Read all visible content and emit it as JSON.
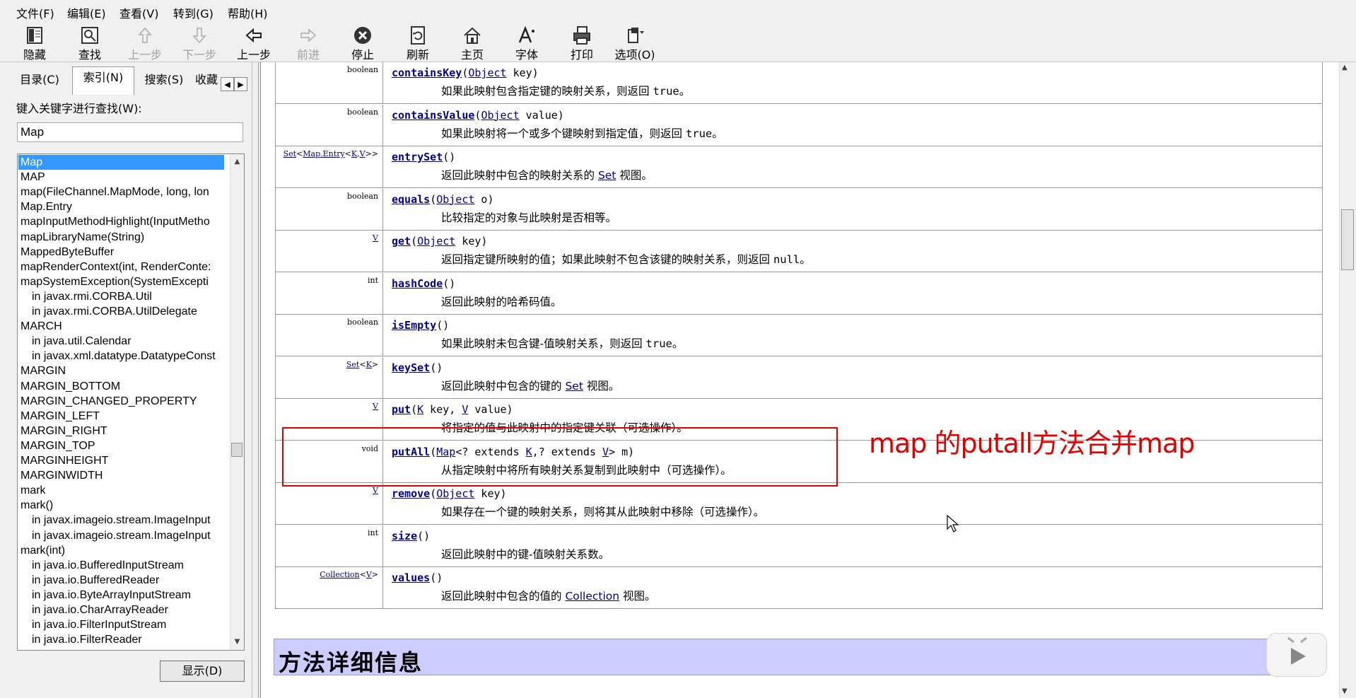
{
  "menu": [
    "文件(F)",
    "编辑(E)",
    "查看(V)",
    "转到(G)",
    "帮助(H)"
  ],
  "toolbar": {
    "hide": "隐藏",
    "find": "查找",
    "prev_topic": "上一步",
    "next_topic": "下一步",
    "back": "上一步",
    "forward": "前进",
    "stop": "停止",
    "refresh": "刷新",
    "home": "主页",
    "font": "字体",
    "print": "打印",
    "options": "选项(O)"
  },
  "sidebar": {
    "tabs": [
      "目录(C)",
      "索引(N)",
      "搜索(S)",
      "收藏"
    ],
    "active_tab": 1,
    "keyword_label": "键入关键字进行查找(W):",
    "keyword_value": "Map",
    "display_button": "显示(D)",
    "items": [
      {
        "text": "Map",
        "indent": false,
        "selected": true
      },
      {
        "text": "MAP",
        "indent": false
      },
      {
        "text": "map(FileChannel.MapMode, long, lon",
        "indent": false
      },
      {
        "text": "Map.Entry",
        "indent": false
      },
      {
        "text": "mapInputMethodHighlight(InputMetho",
        "indent": false
      },
      {
        "text": "mapLibraryName(String)",
        "indent": false
      },
      {
        "text": "MappedByteBuffer",
        "indent": false
      },
      {
        "text": "mapRenderContext(int, RenderConte:",
        "indent": false
      },
      {
        "text": "mapSystemException(SystemExcepti",
        "indent": false
      },
      {
        "text": "in javax.rmi.CORBA.Util",
        "indent": true
      },
      {
        "text": "in javax.rmi.CORBA.UtilDelegate",
        "indent": true
      },
      {
        "text": "MARCH",
        "indent": false
      },
      {
        "text": "in java.util.Calendar",
        "indent": true
      },
      {
        "text": "in javax.xml.datatype.DatatypeConst",
        "indent": true
      },
      {
        "text": "MARGIN",
        "indent": false
      },
      {
        "text": "MARGIN_BOTTOM",
        "indent": false
      },
      {
        "text": "MARGIN_CHANGED_PROPERTY",
        "indent": false
      },
      {
        "text": "MARGIN_LEFT",
        "indent": false
      },
      {
        "text": "MARGIN_RIGHT",
        "indent": false
      },
      {
        "text": "MARGIN_TOP",
        "indent": false
      },
      {
        "text": "MARGINHEIGHT",
        "indent": false
      },
      {
        "text": "MARGINWIDTH",
        "indent": false
      },
      {
        "text": "mark",
        "indent": false
      },
      {
        "text": "mark()",
        "indent": false
      },
      {
        "text": "in javax.imageio.stream.ImageInput",
        "indent": true
      },
      {
        "text": "in javax.imageio.stream.ImageInput",
        "indent": true
      },
      {
        "text": "mark(int)",
        "indent": false
      },
      {
        "text": "in java.io.BufferedInputStream",
        "indent": true
      },
      {
        "text": "in java.io.BufferedReader",
        "indent": true
      },
      {
        "text": "in java.io.ByteArrayInputStream",
        "indent": true
      },
      {
        "text": "in java.io.CharArrayReader",
        "indent": true
      },
      {
        "text": "in java.io.FilterInputStream",
        "indent": true
      },
      {
        "text": "in java.io.FilterReader",
        "indent": true
      }
    ]
  },
  "methods": [
    {
      "type": "boolean",
      "name": "containsKey",
      "sig": "(<a>Object</a> key)",
      "desc": "如果此映射包含指定键的映射关系，则返回 <m>true</m>。"
    },
    {
      "type": "boolean",
      "name": "containsValue",
      "sig": "(<a>Object</a> value)",
      "desc": "如果此映射将一个或多个键映射到指定值，则返回 <m>true</m>。"
    },
    {
      "type": "<a>Set</a>&lt;<a>Map.Entry</a>&lt;<a>K</a>,<a>V</a>&gt;&gt;",
      "name": "entrySet",
      "sig": "()",
      "desc": "返回此映射中包含的映射关系的 <a>Set</a> 视图。"
    },
    {
      "type": "boolean",
      "name": "equals",
      "sig": "(<a>Object</a> o)",
      "desc": "比较指定的对象与此映射是否相等。"
    },
    {
      "type": "<a>V</a>",
      "name": "get",
      "sig": "(<a>Object</a> key)",
      "desc": "返回指定键所映射的值；如果此映射不包含该键的映射关系，则返回 <m>null</m>。"
    },
    {
      "type": "int",
      "name": "hashCode",
      "sig": "()",
      "desc": "返回此映射的哈希码值。"
    },
    {
      "type": "boolean",
      "name": "isEmpty",
      "sig": "()",
      "desc": "如果此映射未包含键-值映射关系，则返回 <m>true</m>。"
    },
    {
      "type": "<a>Set</a>&lt;<a>K</a>&gt;",
      "name": "keySet",
      "sig": "()",
      "desc": "返回此映射中包含的键的 <a>Set</a> 视图。"
    },
    {
      "type": "<a>V</a>",
      "name": "put",
      "sig": "(<a>K</a> key, <a>V</a> value)",
      "desc": "将指定的值与此映射中的指定键关联（可选操作）。"
    },
    {
      "type": "void",
      "name": "putAll",
      "sig": "(<a>Map</a>&lt;? extends <a>K</a>,? extends <a>V</a>&gt; m)",
      "desc": "从指定映射中将所有映射关系复制到此映射中（可选操作）。"
    },
    {
      "type": "<a>V</a>",
      "name": "remove",
      "sig": "(<a>Object</a> key)",
      "desc": "如果存在一个键的映射关系，则将其从此映射中移除（可选操作）。"
    },
    {
      "type": "int",
      "name": "size",
      "sig": "()",
      "desc": "返回此映射中的键-值映射关系数。"
    },
    {
      "type": "<a>Collection</a>&lt;<a>V</a>&gt;",
      "name": "values",
      "sig": "()",
      "desc": "返回此映射中包含的值的 <a>Collection</a> 视图。"
    }
  ],
  "annotation": "map 的putall方法合并map",
  "section_title": "方法详细信息",
  "colors": {
    "link": "#00008b",
    "selection": "#3399ff",
    "annotation": "#e00000",
    "section_bg": "#ccccff"
  },
  "icons": [
    "hide-icon",
    "find-icon",
    "up-arrow-icon",
    "down-arrow-icon",
    "back-arrow-icon",
    "forward-arrow-icon",
    "stop-icon",
    "refresh-icon",
    "home-icon",
    "font-icon",
    "print-icon",
    "options-icon",
    "play-icon"
  ]
}
